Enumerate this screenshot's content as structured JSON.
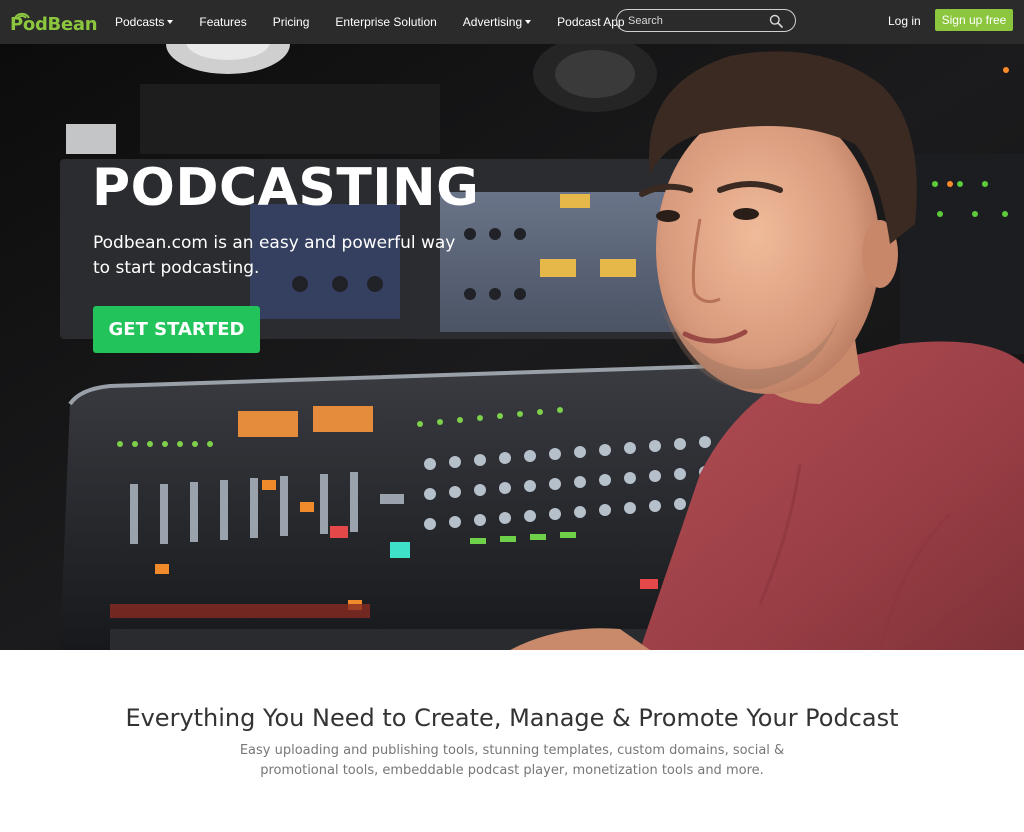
{
  "brand": {
    "logo_text": "PodBean",
    "logo_color": "#8cc63f"
  },
  "nav": {
    "items": [
      {
        "label": "Podcasts",
        "has_dropdown": true
      },
      {
        "label": "Features",
        "has_dropdown": false
      },
      {
        "label": "Pricing",
        "has_dropdown": false
      },
      {
        "label": "Enterprise Solution",
        "has_dropdown": false
      },
      {
        "label": "Advertising",
        "has_dropdown": true
      },
      {
        "label": "Podcast App",
        "has_dropdown": false
      }
    ],
    "search_placeholder": "Search",
    "search_icon": "search-icon",
    "login_label": "Log in",
    "signup_label": "Sign up free",
    "signup_color": "#8cc63f",
    "background": "#2b2b2b"
  },
  "hero": {
    "title": "PODCASTING",
    "subtitle": "Podbean.com is an easy and powerful way to start podcasting.",
    "cta_label": "GET STARTED",
    "cta_color": "#22c35a"
  },
  "features": {
    "title": "Everything You Need to Create, Manage & Promote Your Podcast",
    "subtitle": "Easy uploading and publishing tools, stunning templates, custom domains, social & promotional tools, embeddable podcast player, monetization tools and more."
  }
}
